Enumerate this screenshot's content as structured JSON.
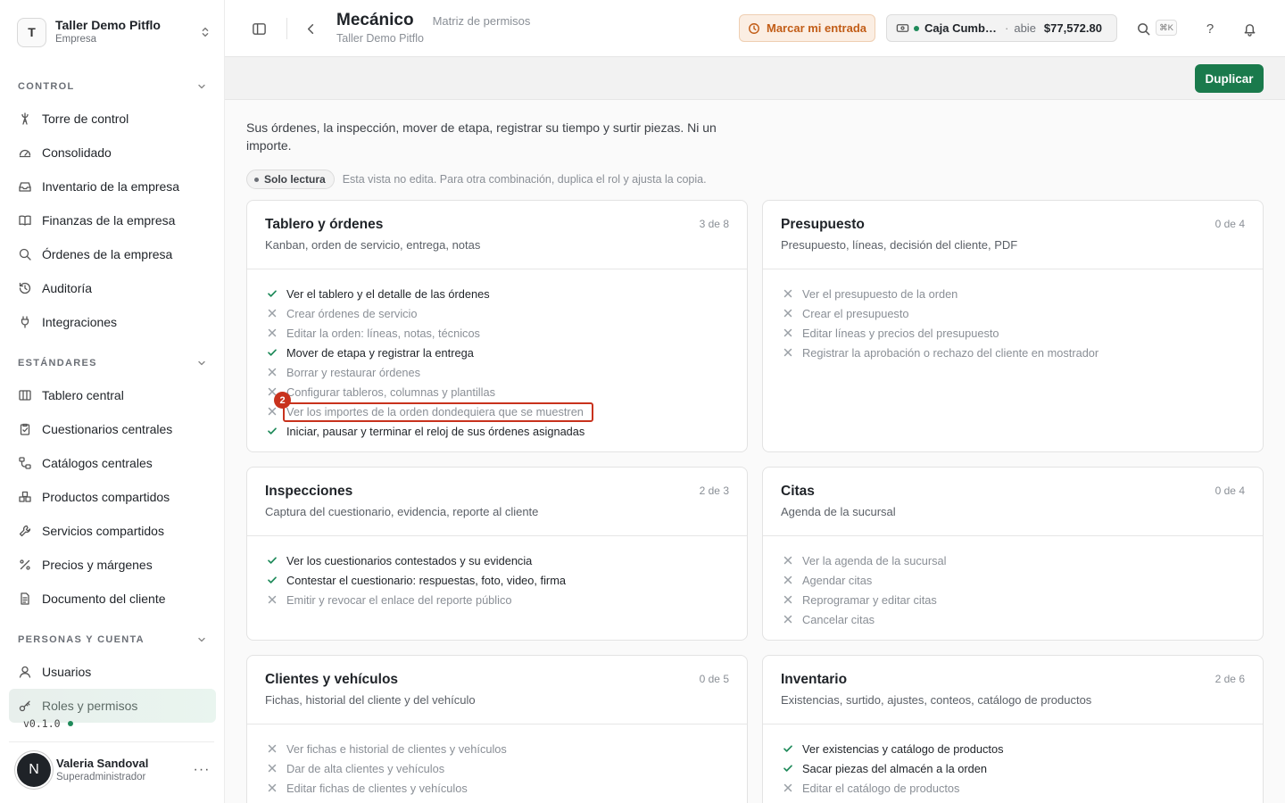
{
  "workspace": {
    "initial": "T",
    "name": "Taller Demo Pitflo",
    "type": "Empresa"
  },
  "sidebar": {
    "sections": [
      {
        "label": "CONTROL",
        "items": [
          {
            "label": "Torre de control",
            "icon": "tower-icon"
          },
          {
            "label": "Consolidado",
            "icon": "gauge-icon"
          },
          {
            "label": "Inventario de la empresa",
            "icon": "inbox-icon"
          },
          {
            "label": "Finanzas de la empresa",
            "icon": "book-icon"
          },
          {
            "label": "Órdenes de la empresa",
            "icon": "search-icon"
          },
          {
            "label": "Auditoría",
            "icon": "history-icon"
          },
          {
            "label": "Integraciones",
            "icon": "plug-icon"
          }
        ]
      },
      {
        "label": "ESTÁNDARES",
        "items": [
          {
            "label": "Tablero central",
            "icon": "columns-icon"
          },
          {
            "label": "Cuestionarios centrales",
            "icon": "clipboard-icon"
          },
          {
            "label": "Catálogos centrales",
            "icon": "workflow-icon"
          },
          {
            "label": "Productos compartidos",
            "icon": "boxes-icon"
          },
          {
            "label": "Servicios compartidos",
            "icon": "wrench-icon"
          },
          {
            "label": "Precios y márgenes",
            "icon": "percent-icon"
          },
          {
            "label": "Documento del cliente",
            "icon": "document-icon"
          }
        ]
      },
      {
        "label": "PERSONAS Y CUENTA",
        "items": [
          {
            "label": "Usuarios",
            "icon": "user-icon"
          },
          {
            "label": "Roles y permisos",
            "icon": "key-icon",
            "active": true
          }
        ]
      }
    ],
    "version": "v0.1.0"
  },
  "user": {
    "initial": "N",
    "name": "Valeria Sandoval",
    "role": "Superadministrador",
    "more_label": "···"
  },
  "header": {
    "title": "Mecánico",
    "subtitle": "Matriz de permisos",
    "workspace": "Taller Demo Pitflo",
    "clock_in_label": "Marcar mi entrada",
    "cash": {
      "name": "Caja Cumbres",
      "separator": "·",
      "state": "abie",
      "amount": "$77,572.80"
    },
    "search_shortcut": "⌘K",
    "help_label": "?"
  },
  "toolbar": {
    "duplicate_label": "Duplicar"
  },
  "description": "Sus órdenes, la inspección, mover de etapa, registrar su tiempo y surtir piezas. Ni un importe.",
  "readonly": {
    "badge": "Solo lectura",
    "note": "Esta vista no edita. Para otra combinación, duplica el rol y ajusta la copia."
  },
  "colors": {
    "accent_green": "#1a7a4c",
    "allowed": "#1f8a5a",
    "denied": "#9aa0a6",
    "clock_in": "#c25d17",
    "annotation": "#c8321d"
  },
  "annotation": {
    "number": "2"
  },
  "cards": [
    {
      "title": "Tablero y órdenes",
      "subtitle": "Kanban, orden de servicio, entrega, notas",
      "count": "3 de 8",
      "permissions": [
        {
          "label": "Ver el tablero y el detalle de las órdenes",
          "granted": true
        },
        {
          "label": "Crear órdenes de servicio",
          "granted": false
        },
        {
          "label": "Editar la orden: líneas, notas, técnicos",
          "granted": false
        },
        {
          "label": "Mover de etapa y registrar la entrega",
          "granted": true
        },
        {
          "label": "Borrar y restaurar órdenes",
          "granted": false
        },
        {
          "label": "Configurar tableros, columnas y plantillas",
          "granted": false
        },
        {
          "label": "Ver los importes de la orden dondequiera que se muestren",
          "granted": false,
          "highlighted": true
        },
        {
          "label": "Iniciar, pausar y terminar el reloj de sus órdenes asignadas",
          "granted": true
        }
      ]
    },
    {
      "title": "Presupuesto",
      "subtitle": "Presupuesto, líneas, decisión del cliente, PDF",
      "count": "0 de 4",
      "permissions": [
        {
          "label": "Ver el presupuesto de la orden",
          "granted": false
        },
        {
          "label": "Crear el presupuesto",
          "granted": false
        },
        {
          "label": "Editar líneas y precios del presupuesto",
          "granted": false
        },
        {
          "label": "Registrar la aprobación o rechazo del cliente en mostrador",
          "granted": false
        }
      ]
    },
    {
      "title": "Inspecciones",
      "subtitle": "Captura del cuestionario, evidencia, reporte al cliente",
      "count": "2 de 3",
      "permissions": [
        {
          "label": "Ver los cuestionarios contestados y su evidencia",
          "granted": true
        },
        {
          "label": "Contestar el cuestionario: respuestas, foto, video, firma",
          "granted": true
        },
        {
          "label": "Emitir y revocar el enlace del reporte público",
          "granted": false
        }
      ]
    },
    {
      "title": "Citas",
      "subtitle": "Agenda de la sucursal",
      "count": "0 de 4",
      "permissions": [
        {
          "label": "Ver la agenda de la sucursal",
          "granted": false
        },
        {
          "label": "Agendar citas",
          "granted": false
        },
        {
          "label": "Reprogramar y editar citas",
          "granted": false
        },
        {
          "label": "Cancelar citas",
          "granted": false
        }
      ]
    },
    {
      "title": "Clientes y vehículos",
      "subtitle": "Fichas, historial del cliente y del vehículo",
      "count": "0 de 5",
      "permissions": [
        {
          "label": "Ver fichas e historial de clientes y vehículos",
          "granted": false
        },
        {
          "label": "Dar de alta clientes y vehículos",
          "granted": false
        },
        {
          "label": "Editar fichas de clientes y vehículos",
          "granted": false
        }
      ]
    },
    {
      "title": "Inventario",
      "subtitle": "Existencias, surtido, ajustes, conteos, catálogo de productos",
      "count": "2 de 6",
      "permissions": [
        {
          "label": "Ver existencias y catálogo de productos",
          "granted": true
        },
        {
          "label": "Sacar piezas del almacén a la orden",
          "granted": true
        },
        {
          "label": "Editar el catálogo de productos",
          "granted": false
        }
      ]
    }
  ]
}
